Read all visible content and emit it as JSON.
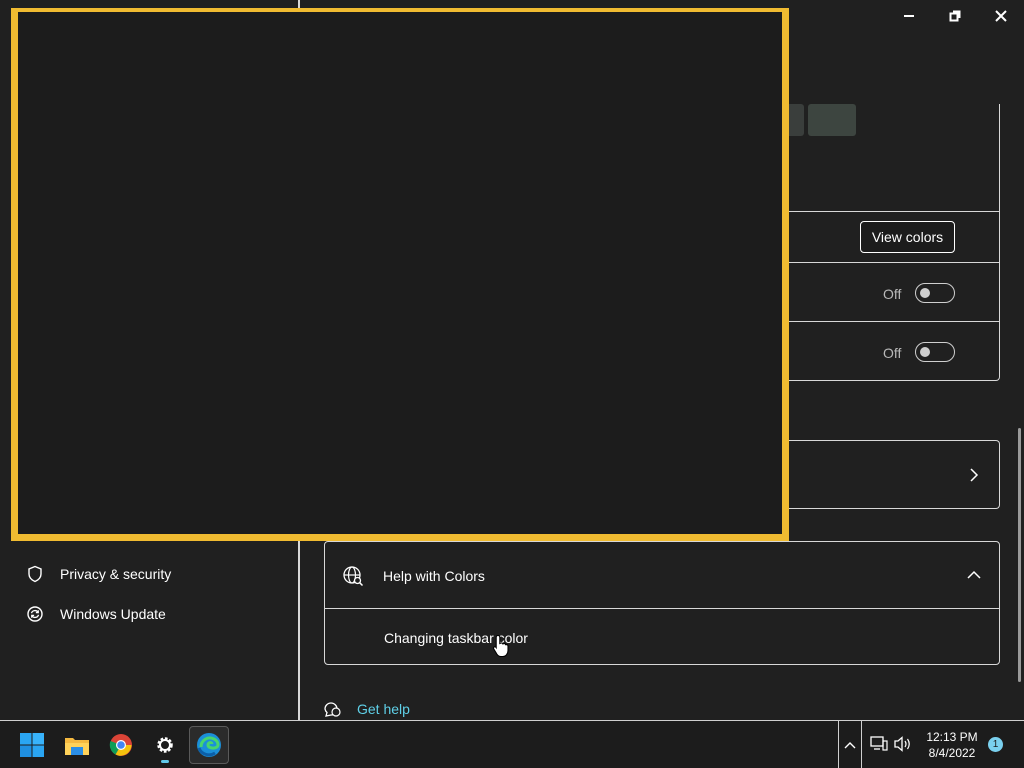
{
  "window": {
    "controls": [
      "minimize-icon",
      "restore-icon",
      "close-icon"
    ]
  },
  "sidebar": {
    "items": [
      {
        "label": "Privacy & security",
        "icon": "shield-icon"
      },
      {
        "label": "Windows Update",
        "icon": "sync-icon"
      }
    ]
  },
  "main": {
    "custom_colors": {
      "button_label": "View colors"
    },
    "toggles": [
      {
        "state_label": "Off",
        "value": false
      },
      {
        "state_label": "Off",
        "value": false
      }
    ],
    "help": {
      "title": "Help with Colors",
      "links": [
        "Changing taskbar color"
      ]
    },
    "get_help": "Get help"
  },
  "taskbar": {
    "apps": [
      "start-icon",
      "file-explorer-icon",
      "chrome-icon",
      "settings-icon",
      "edge-icon"
    ],
    "clock": {
      "time": "12:13 PM",
      "date": "8/4/2022"
    },
    "notification_count": "1"
  },
  "colors": {
    "overlay_border": "#f0bb31",
    "link": "#5fd0e8",
    "background": "#202020"
  }
}
